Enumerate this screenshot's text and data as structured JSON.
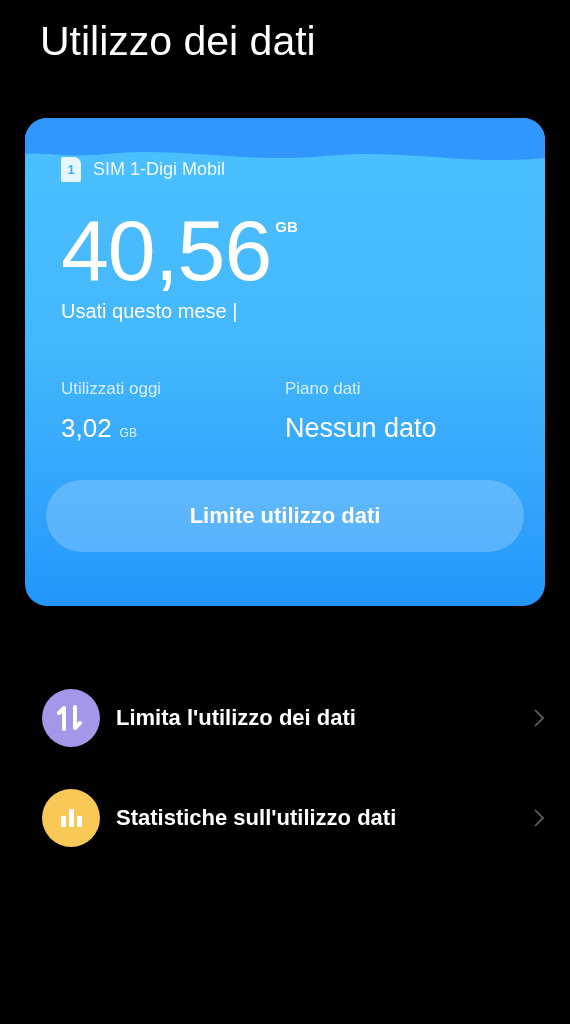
{
  "title": "Utilizzo dei dati",
  "card": {
    "sim_number": "1",
    "sim_name": "SIM 1-Digi Mobil",
    "usage": "40,56",
    "usage_unit": "GB",
    "usage_label": "Usati questo mese |",
    "stats": [
      {
        "label": "Utilizzati oggi",
        "value": "3,02",
        "unit": "GB"
      },
      {
        "label": "Piano dati",
        "value": "Nessun dato"
      }
    ],
    "button": "Limite utilizzo dati"
  },
  "menu": [
    {
      "label": "Limita l'utilizzo dei dati",
      "kind": "arrows",
      "color": "#a496e8"
    },
    {
      "label": "Statistiche sull'utilizzo dati",
      "kind": "bars",
      "color": "#f8c957"
    }
  ]
}
